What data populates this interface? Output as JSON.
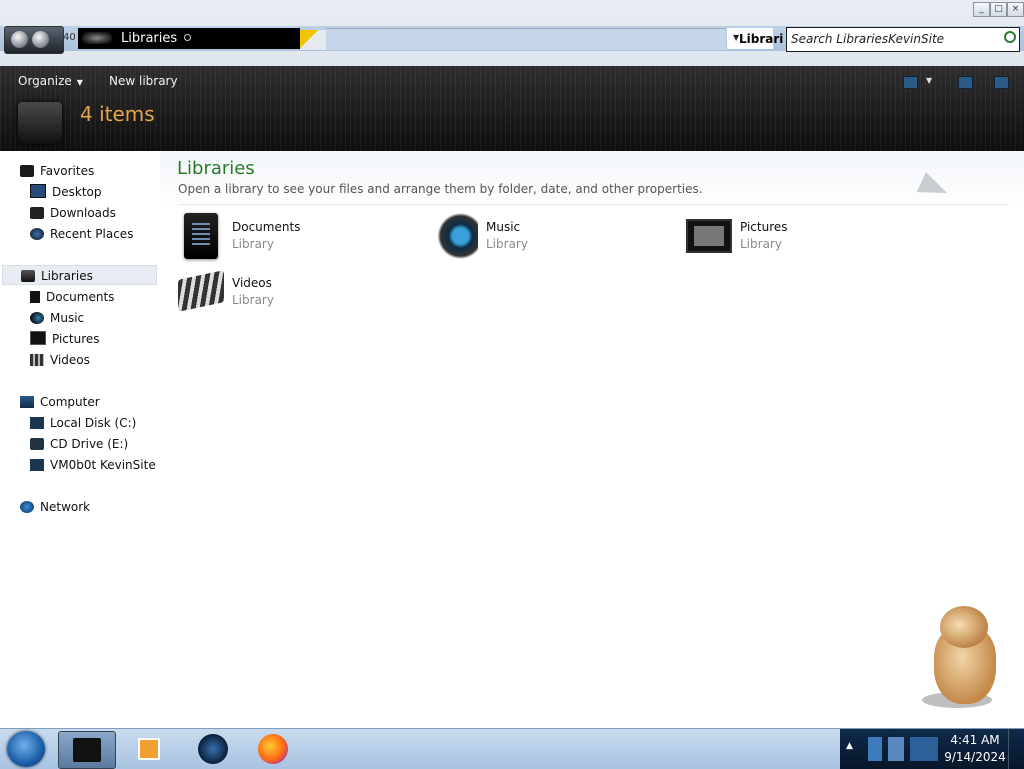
{
  "titlebar": {
    "nav_stub": "40",
    "breadcrumb": "Libraries",
    "address_right": "Librari",
    "search_placeholder": "Search LibrariesKevinSite",
    "window_buttons": {
      "minimize": "_",
      "maximize": "□",
      "close": "×"
    }
  },
  "toolbar": {
    "organize_label": "Organize",
    "new_library_label": "New library",
    "item_count": "4 items",
    "accent_color": "#e5a44a"
  },
  "sidebar": {
    "groups": [
      {
        "label": "Favorites",
        "items": [
          "Desktop",
          "Downloads",
          "Recent Places"
        ]
      },
      {
        "label": "Libraries",
        "items": [
          "Documents",
          "Music",
          "Pictures",
          "Videos"
        ]
      },
      {
        "label": "Computer",
        "items": [
          "Local Disk (C:)",
          "CD Drive (E:)",
          "VM0b0t KevinSite"
        ]
      },
      {
        "label": "Network",
        "items": []
      }
    ],
    "selected": "Libraries"
  },
  "main": {
    "title": "Libraries",
    "subtitle": "Open a library to see your files and arrange them by folder, date, and other properties.",
    "title_color": "#2a7a2a",
    "libraries": [
      {
        "name": "Documents",
        "type": "Library",
        "icon": "documents-icon"
      },
      {
        "name": "Music",
        "type": "Library",
        "icon": "music-icon"
      },
      {
        "name": "Pictures",
        "type": "Library",
        "icon": "pictures-icon"
      },
      {
        "name": "Videos",
        "type": "Library",
        "icon": "videos-icon"
      }
    ]
  },
  "taskbar": {
    "pinned": [
      "windows-explorer-icon",
      "media-player-icon",
      "globe-icon",
      "firefox-icon"
    ],
    "tray_arrow": "▲",
    "time": "4:41 AM",
    "date": "9/14/2024"
  }
}
